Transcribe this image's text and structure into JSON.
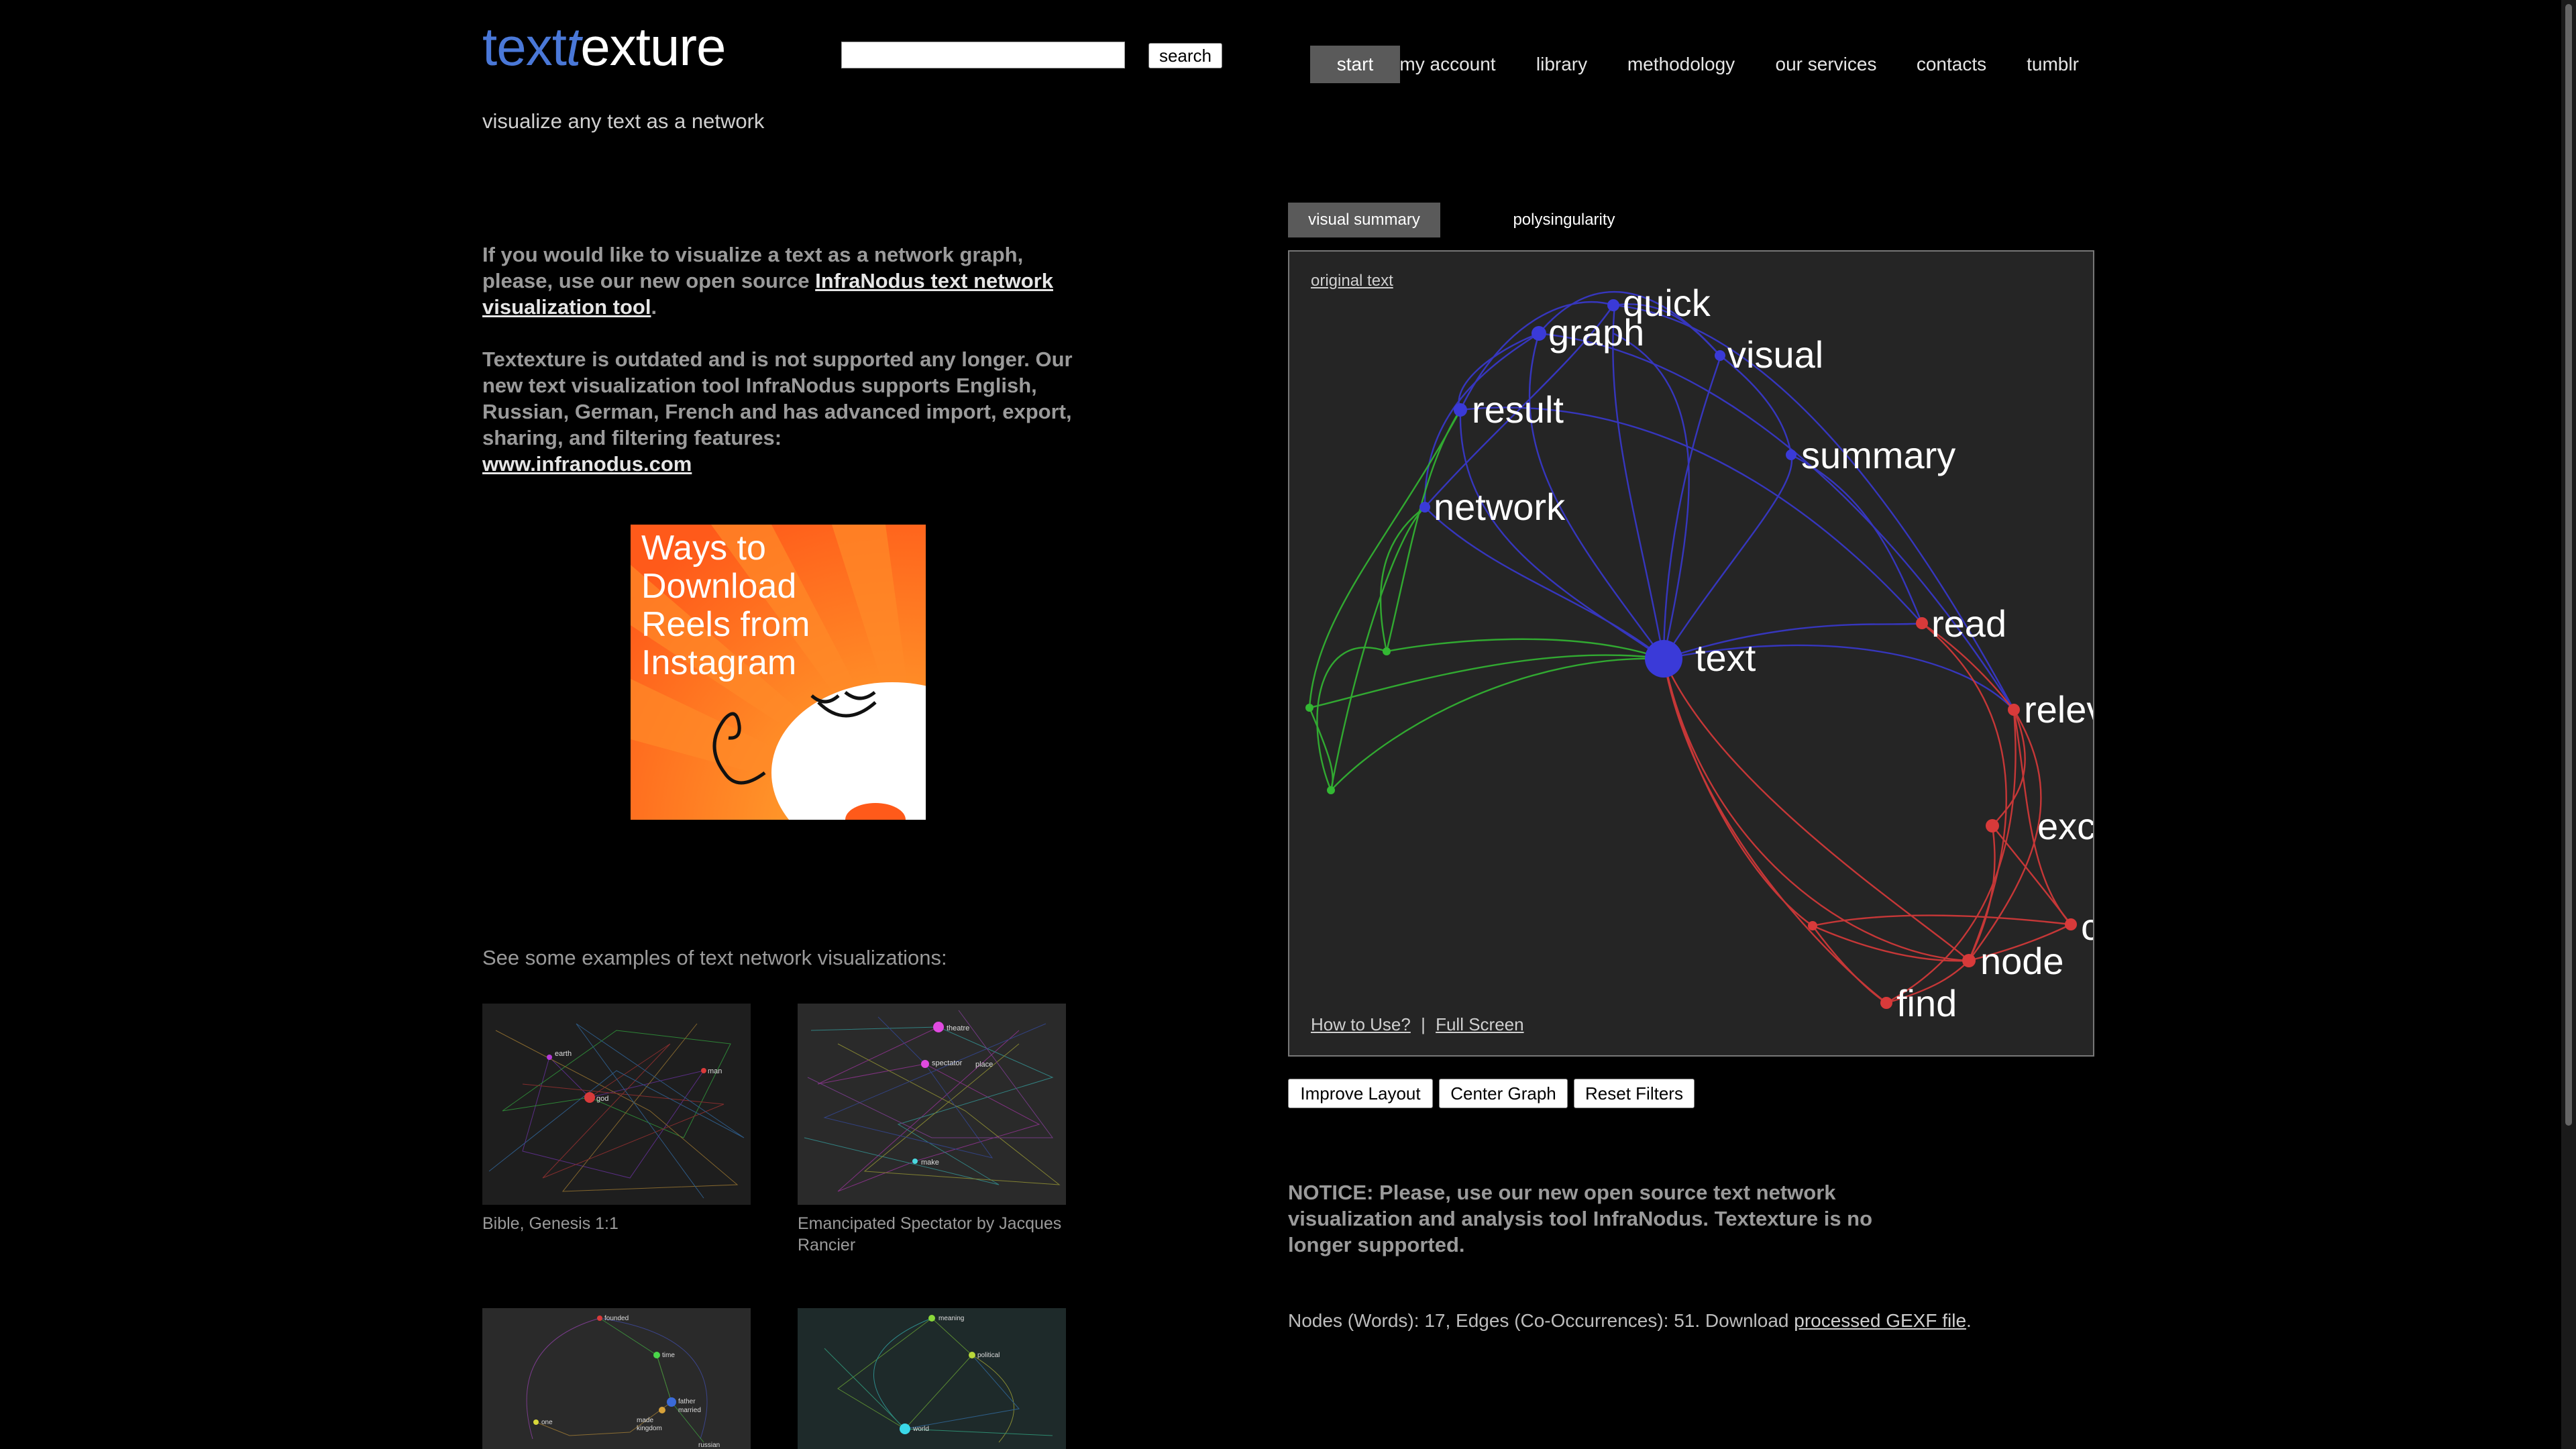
{
  "header": {
    "logo_blue_1": "text",
    "logo_blue_2": "t",
    "logo_rest": "exture",
    "tagline": "visualize any text as a network",
    "search_button": "search"
  },
  "nav": [
    {
      "label": "start"
    },
    {
      "label": "my account"
    },
    {
      "label": "library"
    },
    {
      "label": "methodology"
    },
    {
      "label": "our services"
    },
    {
      "label": "contacts"
    },
    {
      "label": "tumblr"
    }
  ],
  "intro": {
    "p1_a": "If you would like to visualize a text as a network graph, please, use our new open source ",
    "p1_link": "InfraNodus text network visualization tool",
    "p1_b": ".",
    "p2": "Textexture is outdated and is not supported any longer. Our new text visualization tool InfraNodus supports English, Russian, German, French and has advanced import, export, sharing, and filtering features:",
    "p2_link": "www.infranodus.com"
  },
  "ad": {
    "lines": [
      "Ways to",
      "Download",
      "Reels from",
      "Instagram"
    ]
  },
  "examples": {
    "title": "See some examples of text network visualizations:",
    "items": [
      {
        "caption": "Bible, Genesis 1:1",
        "labels": [
          "earth",
          "god",
          "man"
        ]
      },
      {
        "caption": "Emancipated Spectator by Jacques Rancier",
        "labels": [
          "theatre",
          "spectator",
          "place",
          "make"
        ]
      },
      {
        "caption": "",
        "labels": [
          "founded",
          "time",
          "father",
          "married",
          "made",
          "one",
          "kingdom",
          "russian"
        ]
      },
      {
        "caption": "",
        "labels": [
          "meaning",
          "political",
          "world"
        ]
      }
    ]
  },
  "tabs": [
    {
      "label": "visual summary"
    },
    {
      "label": "polysingularity"
    }
  ],
  "graph": {
    "original_text_link": "original text",
    "how_to_use": "How to Use?",
    "separator": "|",
    "full_screen": "Full Screen",
    "colors": {
      "blue": "#3a3ad8",
      "green": "#33b833",
      "red": "#d83a3a"
    },
    "nodes": [
      {
        "label": "quick",
        "color": "blue"
      },
      {
        "label": "graph",
        "color": "blue"
      },
      {
        "label": "visual",
        "color": "blue"
      },
      {
        "label": "result",
        "color": "blue"
      },
      {
        "label": "summary",
        "color": "blue"
      },
      {
        "label": "network",
        "color": "blue"
      },
      {
        "label": "text",
        "color": "blue"
      },
      {
        "label": "read",
        "color": "red"
      },
      {
        "label": "relev",
        "color": "red"
      },
      {
        "label": "exc",
        "color": "red"
      },
      {
        "label": "c",
        "color": "red"
      },
      {
        "label": "node",
        "color": "red"
      },
      {
        "label": "find",
        "color": "red"
      }
    ]
  },
  "controls": {
    "improve_layout": "Improve Layout",
    "center_graph": "Center Graph",
    "reset_filters": "Reset Filters"
  },
  "notice": "NOTICE: Please, use our new open source text network visualization and analysis tool InfraNodus. Textexture is no longer supported.",
  "stats": {
    "text": "Nodes (Words): 17, Edges (Co-Occurrences): 51. Download ",
    "link": "processed GEXF file",
    "end": "."
  }
}
